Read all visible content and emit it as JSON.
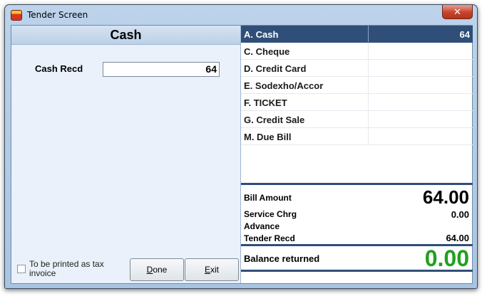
{
  "window": {
    "title": "Tender Screen",
    "close_symbol": "✕"
  },
  "left": {
    "header": "Cash",
    "cash_label": "Cash Recd",
    "cash_value": "64",
    "checkbox_label": "To be printed as tax invoice",
    "checkbox_checked": false,
    "done_prefix": "",
    "done_mnemonic": "D",
    "done_rest": "one",
    "exit_mnemonic": "E",
    "exit_rest": "xit"
  },
  "tenders": [
    {
      "name": "A. Cash",
      "amount": "64",
      "selected": true
    },
    {
      "name": "C. Cheque",
      "amount": ""
    },
    {
      "name": "D. Credit Card",
      "amount": ""
    },
    {
      "name": "E. Sodexho/Accor",
      "amount": ""
    },
    {
      "name": "F. TICKET",
      "amount": ""
    },
    {
      "name": "G. Credit Sale",
      "amount": ""
    },
    {
      "name": "M. Due Bill",
      "amount": ""
    }
  ],
  "summary": {
    "bill_amount_label": "Bill Amount",
    "bill_amount": "64.00",
    "service_chrg_label": "Service Chrg",
    "service_chrg": "0.00",
    "advance_label": "Advance",
    "tender_recd_label": "Tender Recd",
    "tender_recd": "64.00",
    "balance_label": "Balance returned",
    "balance": "0.00"
  },
  "colors": {
    "selected_row": "#2f4f78",
    "balance_green": "#20a020"
  }
}
